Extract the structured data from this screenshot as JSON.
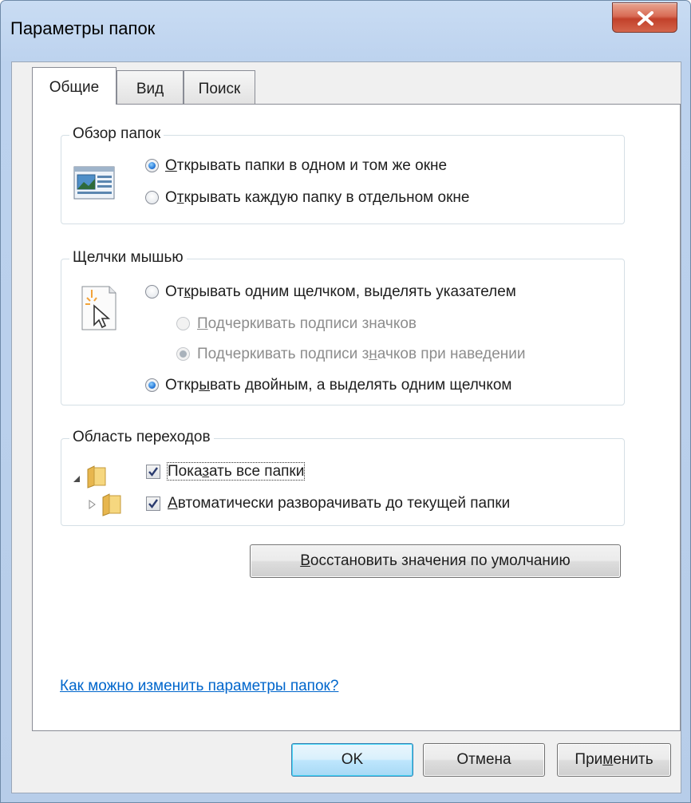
{
  "window": {
    "title": "Параметры папок"
  },
  "tabs": [
    {
      "label": "Общие",
      "active": true
    },
    {
      "label": "Вид",
      "active": false
    },
    {
      "label": "Поиск",
      "active": false
    }
  ],
  "browse": {
    "title": "Обзор папок",
    "icon": "window-preview-icon",
    "options": [
      {
        "pre": "",
        "key": "О",
        "post": "ткрывать папки в одном и том же окне",
        "checked": true
      },
      {
        "pre": "О",
        "key": "т",
        "post": "крывать каждую папку в отдельном окне",
        "checked": false
      }
    ]
  },
  "clicks": {
    "title": "Щелчки мышью",
    "icon": "click-cursor-icon",
    "options": [
      {
        "pre": "От",
        "key": "к",
        "post": "рывать одним щелчком, выделять указателем",
        "checked": false,
        "disabled": false
      },
      {
        "pre": "",
        "key": "П",
        "post": "одчеркивать подписи значков",
        "checked": false,
        "disabled": true
      },
      {
        "pre": "Подчеркивать подписи з",
        "key": "н",
        "post": "ачков при наведении",
        "checked": true,
        "disabled": true
      },
      {
        "pre": "Откр",
        "key": "ы",
        "post": "вать двойным, а выделять одним щелчком",
        "checked": true,
        "disabled": false
      }
    ]
  },
  "navpane": {
    "title": "Область переходов",
    "options": [
      {
        "pre": "Пока",
        "key": "з",
        "post": "ать все папки",
        "checked": true
      },
      {
        "pre": "",
        "key": "А",
        "post": "втоматически разворачивать до текущей папки",
        "checked": true
      }
    ]
  },
  "restore": {
    "pre": "",
    "key": "В",
    "post": "осстановить значения по умолчанию"
  },
  "help_link": "Как можно изменить параметры папок?",
  "buttons": {
    "ok": "OK",
    "cancel": "Отмена",
    "apply_pre": "При",
    "apply_key": "м",
    "apply_post": "енить"
  },
  "colors": {
    "link": "#0066cc",
    "close": "#c2412a",
    "accent": "#1b6ed2"
  }
}
